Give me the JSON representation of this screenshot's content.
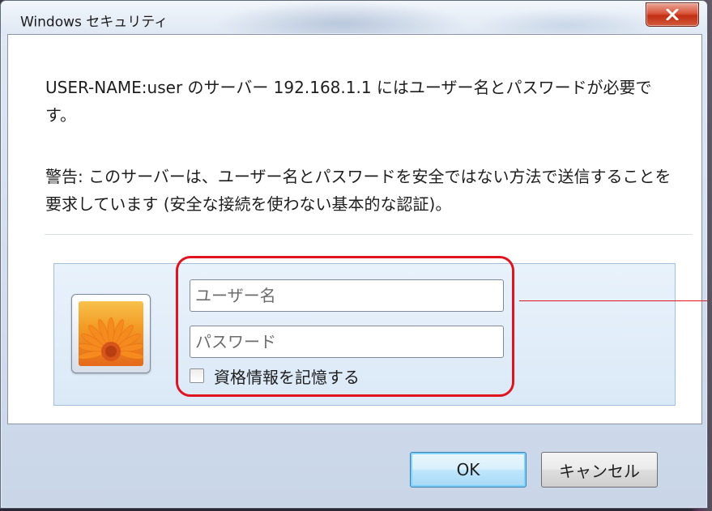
{
  "window": {
    "title": "Windows セキュリティ",
    "close_icon": "close-icon"
  },
  "message": {
    "line1": "USER-NAME:user のサーバー 192.168.1.1 にはユーザー名とパスワードが必要です。",
    "warning": "警告: このサーバーは、ユーザー名とパスワードを安全ではない方法で送信することを要求しています (安全な接続を使わない基本的な認証)。"
  },
  "credentials": {
    "avatar_icon": "user-tile-flower-icon",
    "username_placeholder": "ユーザー名",
    "username_value": "",
    "password_placeholder": "パスワード",
    "password_value": "",
    "remember_label": "資格情報を記憶する",
    "remember_checked": false
  },
  "buttons": {
    "ok_label": "OK",
    "cancel_label": "キャンセル"
  },
  "colors": {
    "highlight": "#e0141e",
    "panel_background": "#dbe9f7",
    "close_button": "#c22f14"
  }
}
